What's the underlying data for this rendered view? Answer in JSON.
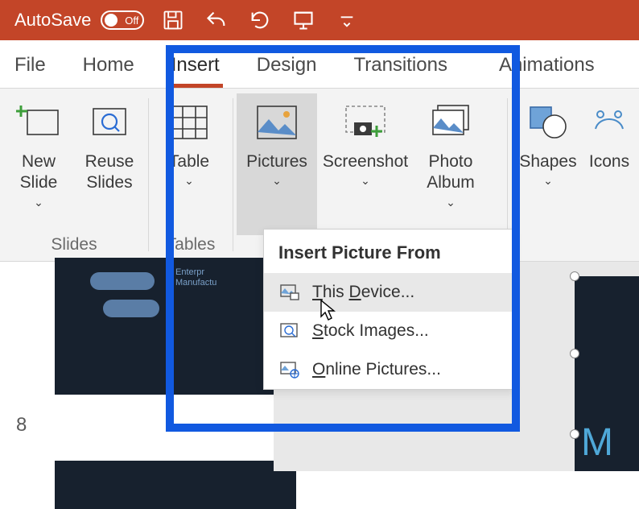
{
  "titlebar": {
    "autosave_label": "AutoSave",
    "toggle_state": "Off"
  },
  "tabs": {
    "file": "File",
    "home": "Home",
    "insert": "Insert",
    "design": "Design",
    "transitions": "Transitions",
    "animations": "Animations"
  },
  "ribbon": {
    "slides_group": "Slides",
    "tables_group": "Tables",
    "new_slide": "New\nSlide",
    "reuse_slides": "Reuse\nSlides",
    "table": "Table",
    "pictures": "Pictures",
    "screenshot": "Screenshot",
    "photo_album": "Photo\nAlbum",
    "shapes": "Shapes",
    "icons": "Icons"
  },
  "dropdown": {
    "header": "Insert Picture From",
    "this_device": "his ",
    "this_device_u1": "T",
    "this_device_u2": "D",
    "this_device_rest": "evice...",
    "stock_images": "tock Images...",
    "stock_images_u": "S",
    "online_pictures": "nline Pictures...",
    "online_pictures_u": "O"
  },
  "slide": {
    "number": "8",
    "thumb_text": "Enterpr\nManufactu"
  },
  "colors": {
    "accent": "#c34528",
    "highlight": "#1159e0"
  }
}
